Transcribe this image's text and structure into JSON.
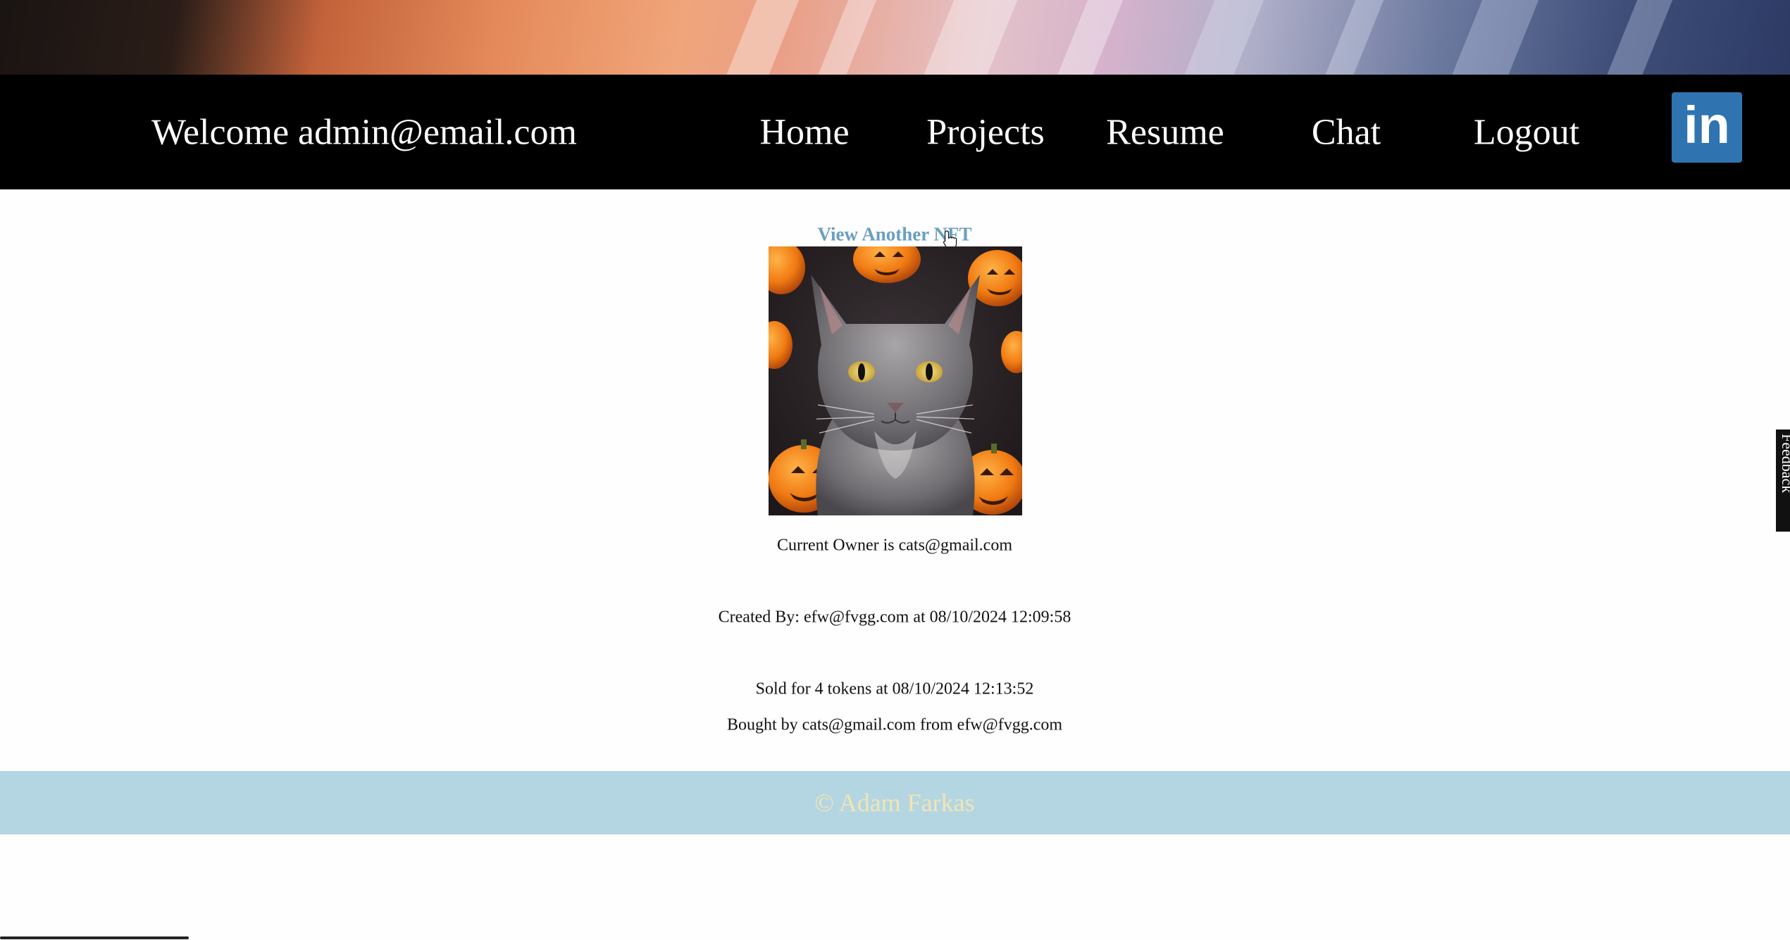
{
  "nav": {
    "welcome": "Welcome admin@email.com",
    "links": [
      "Home",
      "Projects",
      "Resume",
      "Chat",
      "Logout"
    ],
    "linkedin_text": "in"
  },
  "main": {
    "view_another_label": "View Another NFT",
    "nft_image_alt": "cat",
    "owner_line": "Current Owner is cats@gmail.com",
    "created_line": "Created By: efw@fvgg.com at 08/10/2024 12:09:58",
    "sold_line": "Sold for 4 tokens at 08/10/2024 12:13:52",
    "bought_line": "Bought by cats@gmail.com from efw@fvgg.com"
  },
  "footer": {
    "copyright": "© Adam Farkas"
  },
  "feedback": {
    "label": "Feedback"
  },
  "colors": {
    "nav_bg": "#000000",
    "link_accent": "#6a9fc2",
    "footer_bg": "#b3d6e2",
    "footer_text": "#f3e4b4",
    "linkedin_blue": "#2f74b0"
  },
  "icons": [
    "linkedin-icon",
    "hand-pointer-icon"
  ]
}
